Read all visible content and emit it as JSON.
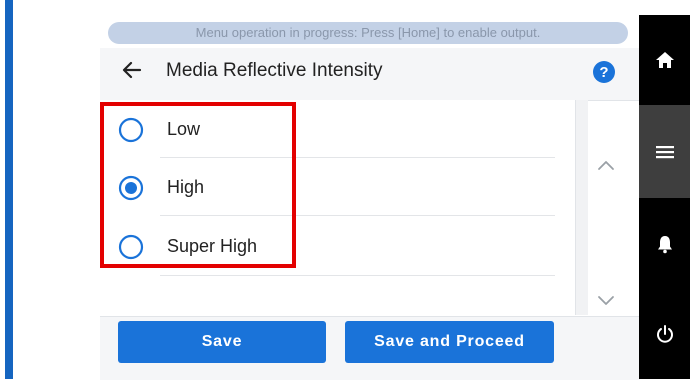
{
  "banner": {
    "text": "Menu operation in progress: Press [Home] to enable output."
  },
  "header": {
    "title": "Media Reflective Intensity"
  },
  "options": [
    {
      "label": "Low",
      "selected": false
    },
    {
      "label": "High",
      "selected": true
    },
    {
      "label": "Super High",
      "selected": false
    }
  ],
  "footer": {
    "save_label": "Save",
    "save_proceed_label": "Save and Proceed"
  },
  "colors": {
    "accent": "#1a73d9",
    "highlight_box": "#e30000",
    "sidebar": "#000000"
  },
  "sidebar": {
    "icons": [
      "home-icon",
      "menu-icon",
      "bell-icon",
      "power-icon"
    ],
    "active": "menu-icon"
  }
}
